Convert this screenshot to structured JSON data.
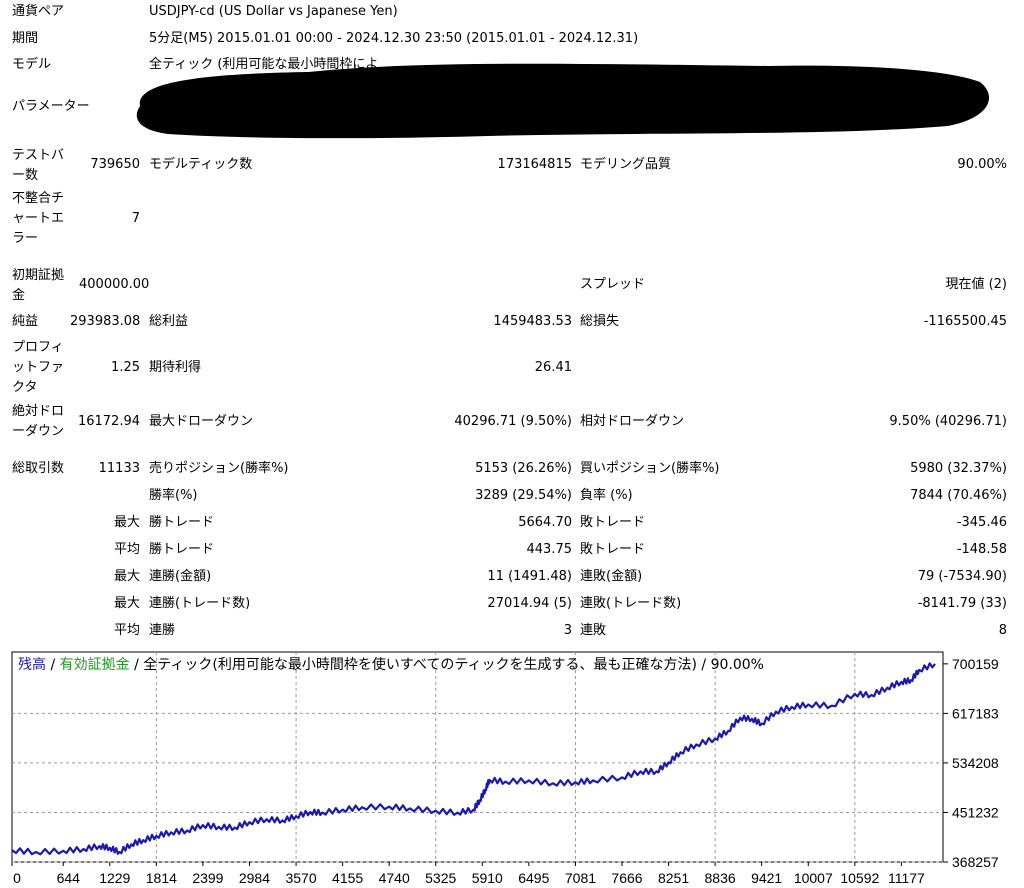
{
  "header": {
    "symbol_label": "通貨ペア",
    "symbol_value": "USDJPY-cd (US Dollar vs Japanese Yen)",
    "period_label": "期間",
    "period_value": "5分足(M5) 2015.01.01 00:00 - 2024.12.30 23:50 (2015.01.01 - 2024.12.31)",
    "model_label": "モデル",
    "model_value": "全ティック (利用可能な最小時間枠によ",
    "params_label": "パラメーター"
  },
  "stats": {
    "bars_label": "テストバー数",
    "bars_value": "739650",
    "ticks_label": "モデルティック数",
    "ticks_value": "173164815",
    "quality_label": "モデリング品質",
    "quality_value": "90.00%",
    "mismatch_label": "不整合チャートエラー",
    "mismatch_value": "7",
    "deposit_label": "初期証拠金",
    "deposit_value": "400000.00",
    "spread_label": "スプレッド",
    "spread_value": "現在値 (2)",
    "net_label": "純益",
    "net_value": "293983.08",
    "gross_profit_label": "総利益",
    "gross_profit_value": "1459483.53",
    "gross_loss_label": "総損失",
    "gross_loss_value": "-1165500.45",
    "pf_label": "プロフィットファクタ",
    "pf_value": "1.25",
    "payoff_label": "期待利得",
    "payoff_value": "26.41",
    "abs_dd_label": "絶対ドローダウン",
    "abs_dd_value": "16172.94",
    "max_dd_label": "最大ドローダウン",
    "max_dd_value": "40296.71 (9.50%)",
    "rel_dd_label": "相対ドローダウン",
    "rel_dd_value": "9.50% (40296.71)",
    "total_label": "総取引数",
    "total_value": "11133",
    "short_label": "売りポジション(勝率%)",
    "short_value": "5153 (26.26%)",
    "long_label": "買いポジション(勝率%)",
    "long_value": "5980 (32.37%)",
    "win_label": "勝率(%)",
    "win_value": "3289 (29.54%)",
    "loss_label": "負率 (%)",
    "loss_value": "7844 (70.46%)",
    "max_prefix": "最大",
    "avg_prefix": "平均",
    "win_trade_label": "勝トレード",
    "loss_trade_label": "敗トレード",
    "max_win_trade": "5664.70",
    "max_loss_trade": "-345.46",
    "avg_win_trade": "443.75",
    "avg_loss_trade": "-148.58",
    "consec_win_amt_label": "連勝(金額)",
    "consec_win_amt_value": "11 (1491.48)",
    "consec_loss_amt_label": "連敗(金額)",
    "consec_loss_amt_value": "79 (-7534.90)",
    "consec_win_cnt_label": "連勝(トレード数)",
    "consec_win_cnt_value": "27014.94 (5)",
    "consec_loss_cnt_label": "連敗(トレード数)",
    "consec_loss_cnt_value": "-8141.79 (33)",
    "avg_consec_win_label": "連勝",
    "avg_consec_win_value": "3",
    "avg_consec_loss_label": "連敗",
    "avg_consec_loss_value": "8"
  },
  "caption": {
    "balance": "残高",
    "sep1": " / ",
    "equity": "有効証拠金",
    "sep2": " / ",
    "rest": "全ティック(利用可能な最小時間枠を使いすべてのティックを生成する、最も正確な方法) / 90.00%"
  },
  "colors": {
    "balance": "#1a1ab0",
    "equity": "#1aa01a",
    "grid": "#9a9a9a"
  },
  "chart_data": {
    "type": "line",
    "x_ticks": [
      0,
      644,
      1229,
      1814,
      2399,
      2984,
      3570,
      4155,
      4740,
      5325,
      5910,
      6495,
      7081,
      7666,
      8251,
      8836,
      9421,
      10007,
      10592,
      11177
    ],
    "y_ticks": [
      700159,
      617183,
      534208,
      451232,
      368257
    ],
    "ylim": [
      368257,
      720000
    ],
    "xlim": [
      0,
      11700
    ],
    "series": [
      {
        "name": "残高",
        "x": [
          0,
          300,
          644,
          900,
          1100,
          1229,
          1350,
          1500,
          1650,
          1814,
          2000,
          2200,
          2399,
          2600,
          2800,
          2984,
          3200,
          3400,
          3570,
          3750,
          3900,
          4155,
          4400,
          4740,
          5000,
          5325,
          5600,
          5800,
          5880,
          5950,
          6000,
          6200,
          6495,
          6800,
          7081,
          7300,
          7666,
          7900,
          8100,
          8251,
          8400,
          8600,
          8836,
          9000,
          9150,
          9300,
          9421,
          9600,
          9800,
          10007,
          10300,
          10592,
          10800,
          11000,
          11177,
          11300,
          11400,
          11600
        ],
        "y": [
          388000,
          385000,
          387000,
          390000,
          395000,
          392000,
          385000,
          398000,
          405000,
          412000,
          418000,
          421000,
          430000,
          427000,
          426000,
          435000,
          440000,
          438000,
          445000,
          452000,
          451000,
          456000,
          460000,
          461000,
          458000,
          454000,
          451000,
          456000,
          472000,
          490000,
          506000,
          503000,
          505000,
          500000,
          502000,
          505000,
          510000,
          520000,
          520000,
          535000,
          552000,
          565000,
          575000,
          588000,
          610000,
          608000,
          600000,
          620000,
          628000,
          632000,
          630000,
          650000,
          648000,
          660000,
          670000,
          673000,
          690000,
          700000
        ]
      }
    ]
  }
}
